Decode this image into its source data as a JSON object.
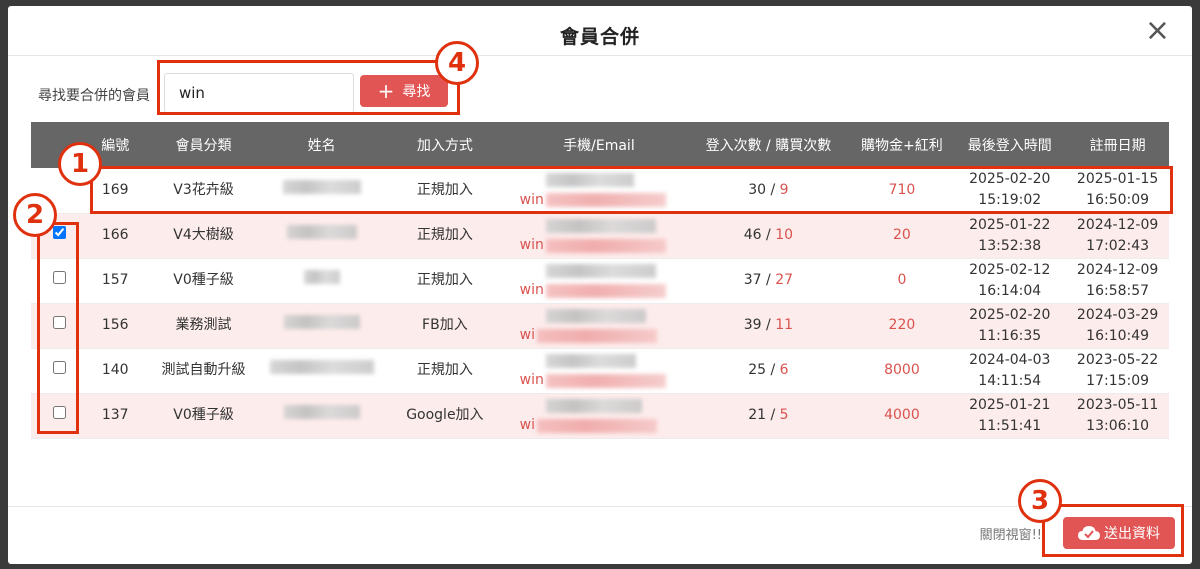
{
  "modal": {
    "title": "會員合併",
    "close": "×"
  },
  "search": {
    "label": "尋找要合併的會員",
    "value": "win",
    "button_label": "尋找"
  },
  "table": {
    "headers": [
      "編號",
      "會員分類",
      "姓名",
      "加入方式",
      "手機/Email",
      "登入次數 / 購買次數",
      "購物金+紅利",
      "最後登入時間",
      "註冊日期"
    ],
    "rows": [
      {
        "checked": null,
        "id": "169",
        "category": "V3花卉級",
        "join": "正規加入",
        "win": "win",
        "logins": "30",
        "sep": " / ",
        "purchases": "9",
        "points": "710",
        "last_login_date": "2025-02-20",
        "last_login_time": "15:19:02",
        "reg_date": "2025-01-15",
        "reg_time": "16:50:09"
      },
      {
        "checked": true,
        "id": "166",
        "category": "V4大樹級",
        "join": "正規加入",
        "win": "win",
        "logins": "46",
        "sep": " / ",
        "purchases": "10",
        "points": "20",
        "last_login_date": "2025-01-22",
        "last_login_time": "13:52:38",
        "reg_date": "2024-12-09",
        "reg_time": "17:02:43"
      },
      {
        "checked": false,
        "id": "157",
        "category": "V0種子級",
        "join": "正規加入",
        "win": "win",
        "logins": "37",
        "sep": " / ",
        "purchases": "27",
        "points": "0",
        "last_login_date": "2025-02-12",
        "last_login_time": "16:14:04",
        "reg_date": "2024-12-09",
        "reg_time": "16:58:57"
      },
      {
        "checked": false,
        "id": "156",
        "category": "業務測試",
        "join": "FB加入",
        "win": "wi",
        "logins": "39",
        "sep": " / ",
        "purchases": "11",
        "points": "220",
        "last_login_date": "2025-02-20",
        "last_login_time": "11:16:35",
        "reg_date": "2024-03-29",
        "reg_time": "16:10:49"
      },
      {
        "checked": false,
        "id": "140",
        "category": "測試自動升級",
        "join": "正規加入",
        "win": "win",
        "logins": "25",
        "sep": " / ",
        "purchases": "6",
        "points": "8000",
        "last_login_date": "2024-04-03",
        "last_login_time": "14:11:54",
        "reg_date": "2023-05-22",
        "reg_time": "17:15:09"
      },
      {
        "checked": false,
        "id": "137",
        "category": "V0種子級",
        "join": "Google加入",
        "win": "wi",
        "logins": "21",
        "sep": " / ",
        "purchases": "5",
        "points": "4000",
        "last_login_date": "2025-01-21",
        "last_login_time": "11:51:41",
        "reg_date": "2023-05-11",
        "reg_time": "13:06:10"
      }
    ]
  },
  "footer": {
    "close_text": "關閉視窗!!",
    "submit_label": "送出資料"
  },
  "annotations": [
    "1",
    "2",
    "3",
    "4"
  ],
  "colors": {
    "accent": "#e25555",
    "annotation": "#e0310f",
    "header_bg": "#666666",
    "row_pink": "#fdecec"
  }
}
